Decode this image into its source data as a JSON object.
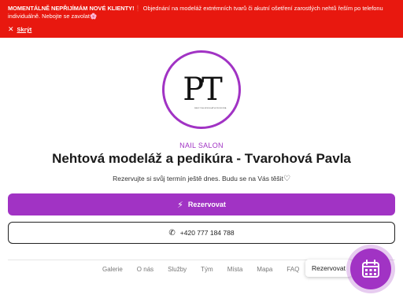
{
  "banner": {
    "bold_text": "MOMENTÁLNĚ NEPŘIJÍMÁM NOVÉ KLIENTY!",
    "emoji": "❗",
    "text": " Objednání na modeláž extrémních tvarů či akutní ošetření zarostlých nehtů řeším po telefonu individuálně. Nebojte se zavolat",
    "trailing_emoji": "🌸",
    "hide_label": "Skrýt",
    "bg_color": "#e8180f"
  },
  "logo": {
    "monogram": "PT",
    "small_text": "NEHTOVÁ MODELÁŽ A PEDIKÚRA",
    "ring_color": "#a133c4"
  },
  "profile": {
    "category": "NAIL SALON",
    "title": "Nehtová modeláž a pedikúra - Tvarohová Pavla",
    "tagline": "Rezervujte si svůj termín ještě dnes. Budu se na Vás těšit"
  },
  "actions": {
    "reserve_label": "Rezervovat",
    "phone_label": "+420 777 184 788"
  },
  "nav": {
    "items": [
      "Galerie",
      "O nás",
      "Služby",
      "Tým",
      "Místa",
      "Mapa",
      "FAQ"
    ]
  },
  "floating": {
    "label": "Rezervovat",
    "icon": "calendar-icon"
  },
  "colors": {
    "accent": "#a133c4",
    "banner": "#e8180f"
  }
}
